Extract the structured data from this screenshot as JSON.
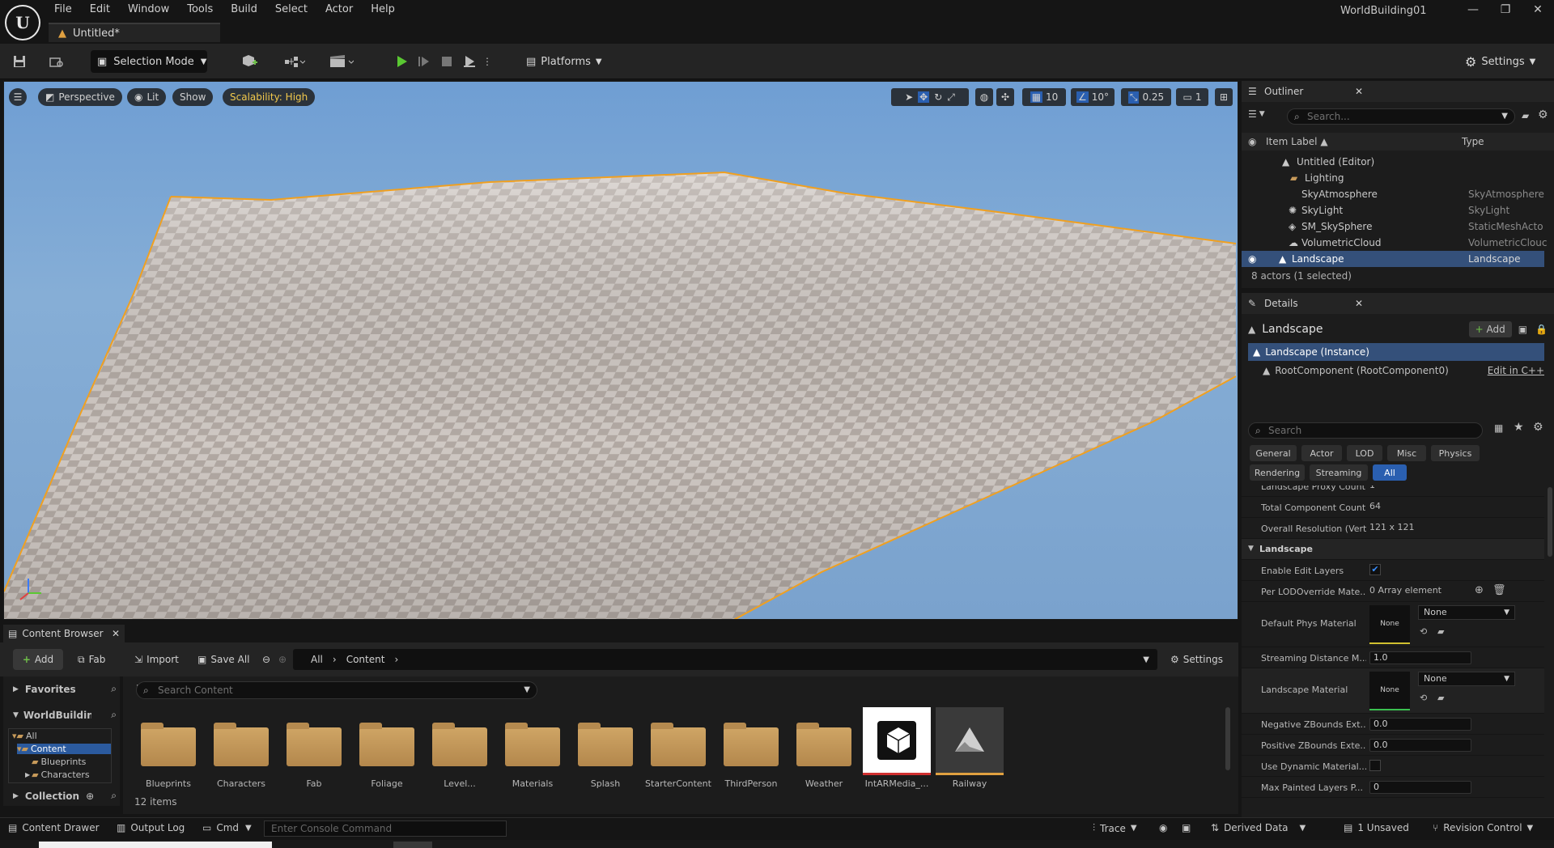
{
  "window": {
    "project_name": "WorldBuilding01",
    "doc_tab": "Untitled*",
    "menu": [
      "File",
      "Edit",
      "Window",
      "Tools",
      "Build",
      "Select",
      "Actor",
      "Help"
    ]
  },
  "toolbar": {
    "selection_mode": "Selection Mode",
    "platforms": "Platforms",
    "settings": "Settings"
  },
  "viewport": {
    "perspective": "Perspective",
    "lit": "Lit",
    "show": "Show",
    "scalability": "Scalability: High",
    "grid_snap": "10",
    "rotation_snap": "10°",
    "scale_snap": "0.25",
    "camera_speed": "1"
  },
  "content_browser": {
    "tab": "Content Browser",
    "add": "Add",
    "fab": "Fab",
    "import": "Import",
    "save_all": "Save All",
    "path": [
      "All",
      "Content"
    ],
    "settings": "Settings",
    "search_placeholder": "Search Content",
    "favorites": "Favorites",
    "project_root": "WorldBuildingC",
    "tree": [
      "All",
      "Content",
      "Blueprints",
      "Characters"
    ],
    "collection": "Collection",
    "item_count": "12 items",
    "assets": [
      {
        "label": "Blueprints",
        "kind": "folder"
      },
      {
        "label": "Characters",
        "kind": "folder"
      },
      {
        "label": "Fab",
        "kind": "folder"
      },
      {
        "label": "Foliage",
        "kind": "folder"
      },
      {
        "label": "Level...",
        "kind": "folder"
      },
      {
        "label": "Materials",
        "kind": "folder"
      },
      {
        "label": "Splash",
        "kind": "folder"
      },
      {
        "label": "StarterContent",
        "kind": "folder"
      },
      {
        "label": "ThirdPerson",
        "kind": "folder"
      },
      {
        "label": "Weather",
        "kind": "folder"
      },
      {
        "label": "IntARMedia_...",
        "kind": "asset-white"
      },
      {
        "label": "Railway",
        "kind": "asset-dark"
      }
    ]
  },
  "statusbar": {
    "content_drawer": "Content Drawer",
    "output_log": "Output Log",
    "cmd": "Cmd",
    "console_placeholder": "Enter Console Command",
    "trace": "Trace",
    "derived_data": "Derived Data",
    "unsaved": "1 Unsaved",
    "revision_control": "Revision Control"
  },
  "outliner": {
    "tab": "Outliner",
    "search_placeholder": "Search...",
    "col_label": "Item Label",
    "col_type": "Type",
    "rows": [
      {
        "label": "Untitled (Editor)",
        "type": ""
      },
      {
        "label": "Lighting",
        "type": ""
      },
      {
        "label": "SkyAtmosphere",
        "type": "SkyAtmosphere"
      },
      {
        "label": "SkyLight",
        "type": "SkyLight"
      },
      {
        "label": "SM_SkySphere",
        "type": "StaticMeshActo"
      },
      {
        "label": "VolumetricCloud",
        "type": "VolumetricClouc"
      },
      {
        "label": "Landscape",
        "type": "Landscape"
      }
    ],
    "summary": "8 actors (1 selected)"
  },
  "details": {
    "tab": "Details",
    "object": "Landscape",
    "add": "Add",
    "instance": "Landscape (Instance)",
    "root_component": "RootComponent (RootComponent0)",
    "edit_cpp": "Edit in C++",
    "search_placeholder": "Search",
    "filters": [
      "General",
      "Actor",
      "LOD",
      "Misc",
      "Physics",
      "Rendering",
      "Streaming",
      "All"
    ],
    "properties": {
      "proxy_count_name": "Landscape Proxy Count",
      "proxy_count_val": "1",
      "total_comp_name": "Total Component Count",
      "total_comp_val": "64",
      "resolution_name": "Overall Resolution (Verts)",
      "resolution_val": "121 x 121",
      "section": "Landscape",
      "edit_layers_name": "Enable Edit Layers",
      "per_lod_name": "Per LODOverride Mate...",
      "per_lod_val": "0 Array element",
      "phys_mat_name": "Default Phys Material",
      "none_thumb": "None",
      "none_combo": "None",
      "streaming_name": "Streaming Distance M...",
      "streaming_val": "1.0",
      "land_mat_name": "Landscape Material",
      "neg_z_name": "Negative ZBounds Ext...",
      "neg_z_val": "0.0",
      "pos_z_name": "Positive ZBounds Exte...",
      "pos_z_val": "0.0",
      "dyn_mat_name": "Use Dynamic Material...",
      "max_painted_name": "Max Painted Layers P...",
      "max_painted_val": "0"
    }
  }
}
